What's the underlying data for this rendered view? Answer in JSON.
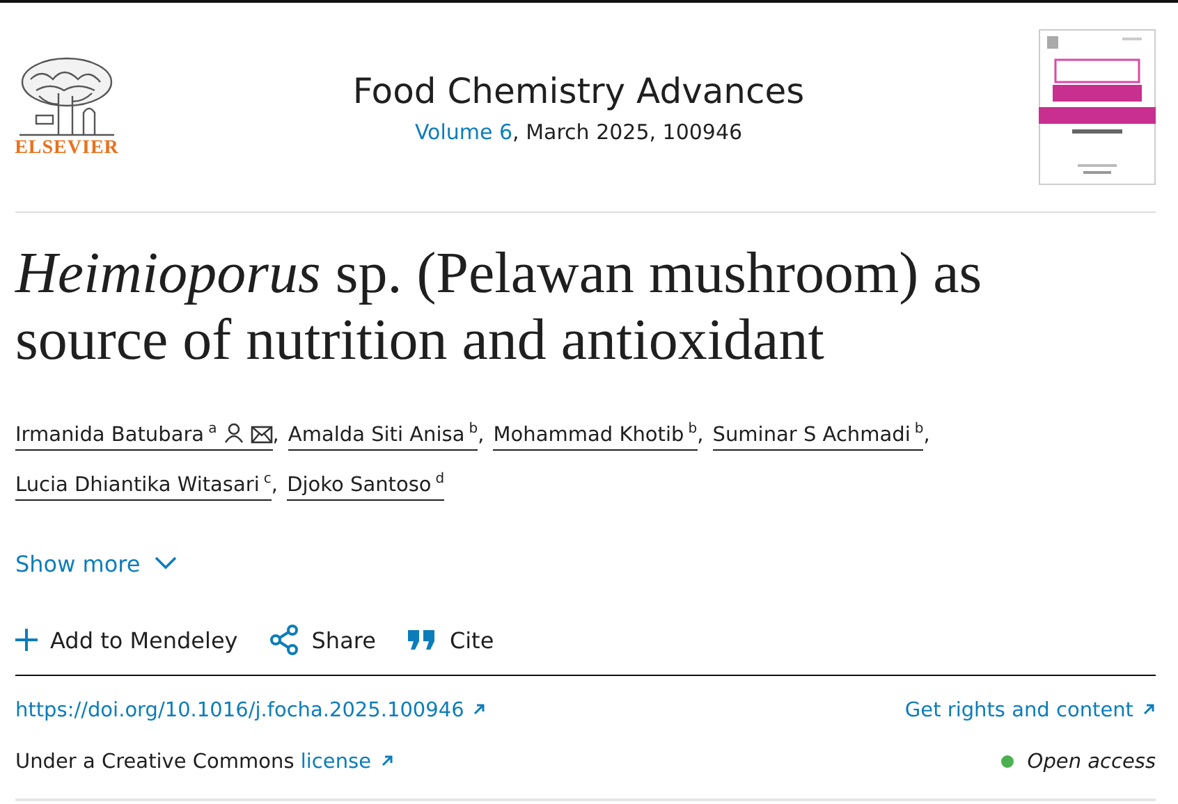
{
  "publisher_logo": {
    "text": "ELSEVIER"
  },
  "journal": {
    "title": "Food Chemistry Advances",
    "volume_link": "Volume 6",
    "issue_info": ", March 2025, 100946"
  },
  "article": {
    "title": "*Heimioporus* sp. (Pelawan mushroom) as source of nutrition and antioxidant"
  },
  "authors": [
    {
      "name": "Irmanida Batubara",
      "affiliation": "a",
      "corresponding": true,
      "separator": ","
    },
    {
      "name": "Amalda Siti Anisa",
      "affiliation": "b",
      "corresponding": false,
      "separator": ","
    },
    {
      "name": "Mohammad Khotib",
      "affiliation": "b",
      "corresponding": false,
      "separator": ","
    },
    {
      "name": "Suminar S Achmadi",
      "affiliation": "b",
      "corresponding": false,
      "separator": ","
    },
    {
      "name": "Lucia Dhiantika Witasari",
      "affiliation": "c",
      "corresponding": false,
      "separator": ","
    },
    {
      "name": "Djoko Santoso",
      "affiliation": "d",
      "corresponding": false
    }
  ],
  "show_more": "Show more",
  "actions": [
    {
      "kind": "add",
      "label": "Add to Mendeley"
    },
    {
      "kind": "share",
      "label": "Share"
    },
    {
      "kind": "cite",
      "label": "Cite"
    }
  ],
  "doi_link": "https://doi.org/10.1016/j.focha.2025.100946",
  "rights_link": "Get rights and content",
  "license": {
    "text": "Under a Creative Commons",
    "link": "license"
  },
  "access": {
    "label": "Open access"
  }
}
